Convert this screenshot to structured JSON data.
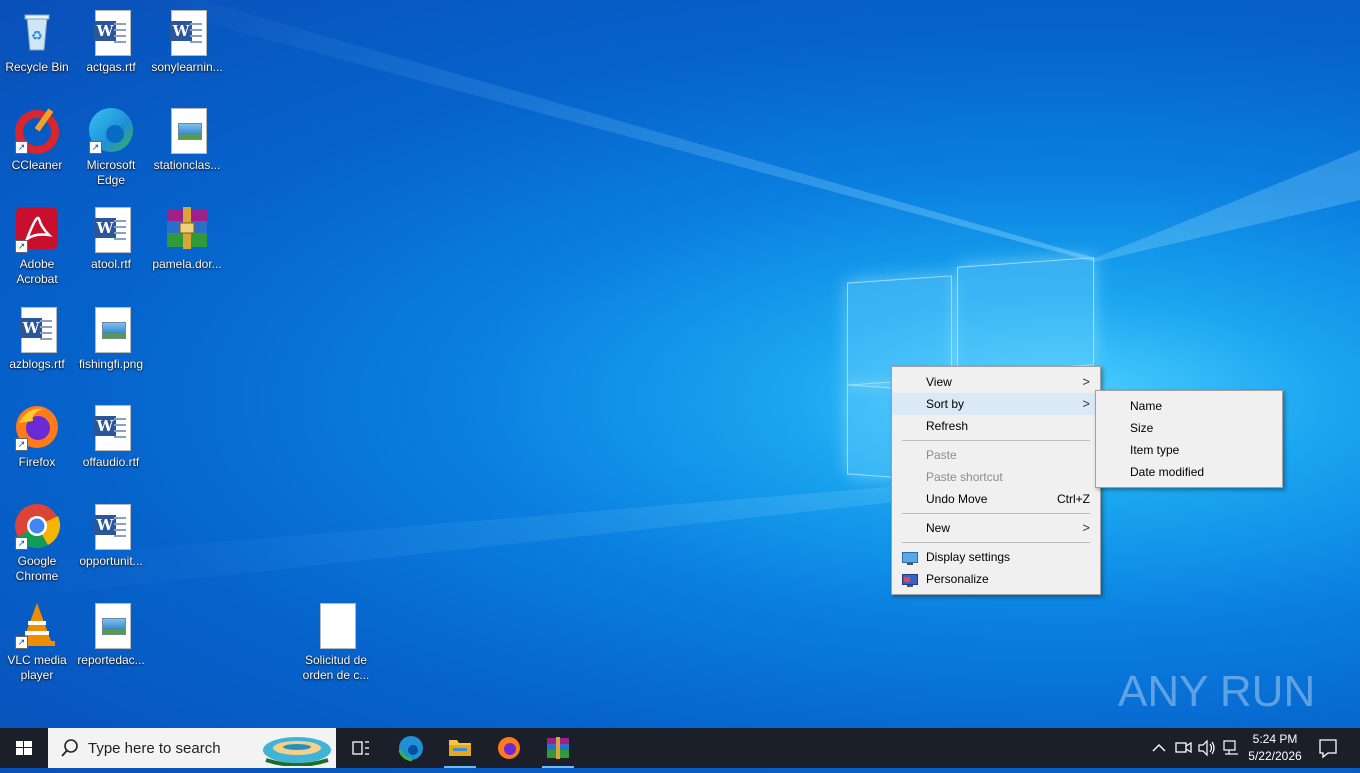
{
  "desktop_icons": [
    {
      "label": "Recycle Bin"
    },
    {
      "label": "actgas.rtf"
    },
    {
      "label": "sonylearnin..."
    },
    {
      "label": "CCleaner"
    },
    {
      "label": "Microsoft Edge"
    },
    {
      "label": "stationclas..."
    },
    {
      "label": "Adobe Acrobat"
    },
    {
      "label": "atool.rtf"
    },
    {
      "label": "pamela.dor..."
    },
    {
      "label": "azblogs.rtf"
    },
    {
      "label": "fishingfi.png"
    },
    {
      "label": "Firefox"
    },
    {
      "label": "offaudio.rtf"
    },
    {
      "label": "Google Chrome"
    },
    {
      "label": "opportunit..."
    },
    {
      "label": "VLC media player"
    },
    {
      "label": "reportedac..."
    },
    {
      "label": "Solicitud de orden de c..."
    }
  ],
  "context_menu": {
    "view": "View",
    "sort_by": "Sort by",
    "refresh": "Refresh",
    "paste": "Paste",
    "paste_shortcut": "Paste shortcut",
    "undo_move": "Undo Move",
    "undo_shortcut": "Ctrl+Z",
    "new": "New",
    "display_settings": "Display settings",
    "personalize": "Personalize"
  },
  "sort_submenu": {
    "name": "Name",
    "size": "Size",
    "item_type": "Item type",
    "date_modified": "Date modified"
  },
  "taskbar": {
    "search_placeholder": "Type here to search",
    "time": "5:24 PM",
    "date": "5/22/2026"
  },
  "watermark": {
    "text": "ANY RUN"
  },
  "colors": {
    "taskbar": "#1b1f2a",
    "menu_bg": "#f0f0f0",
    "menu_highlight": "#dbe9f7",
    "accent": "#0a7fe0"
  }
}
